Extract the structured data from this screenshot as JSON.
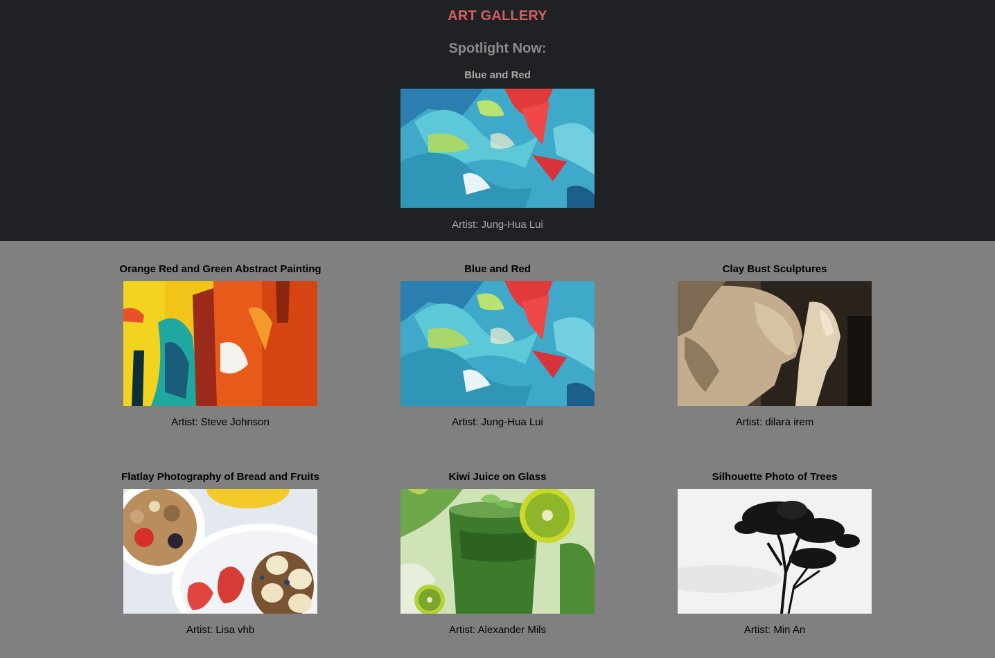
{
  "header": {
    "title": "ART GALLERY",
    "spotlight_heading": "Spotlight Now:"
  },
  "spotlight": {
    "art_title": "Blue and Red",
    "artist": "Artist: Jung-Hua Lui"
  },
  "gallery": [
    {
      "title": "Orange Red and Green Abstract Painting",
      "artist": "Artist: Steve Johnson"
    },
    {
      "title": "Blue and Red",
      "artist": "Artist: Jung-Hua Lui"
    },
    {
      "title": "Clay Bust Sculptures",
      "artist": "Artist: dilara irem"
    },
    {
      "title": "Flatlay Photography of Bread and Fruits",
      "artist": "Artist: Lisa vhb"
    },
    {
      "title": "Kiwi Juice on Glass",
      "artist": "Artist: Alexander Mils"
    },
    {
      "title": "Silhouette Photo of Trees",
      "artist": "Artist: Min An"
    }
  ],
  "colors": {
    "header_bg": "#202124",
    "page_bg": "#808080",
    "title_accent": "#d35f5f"
  }
}
